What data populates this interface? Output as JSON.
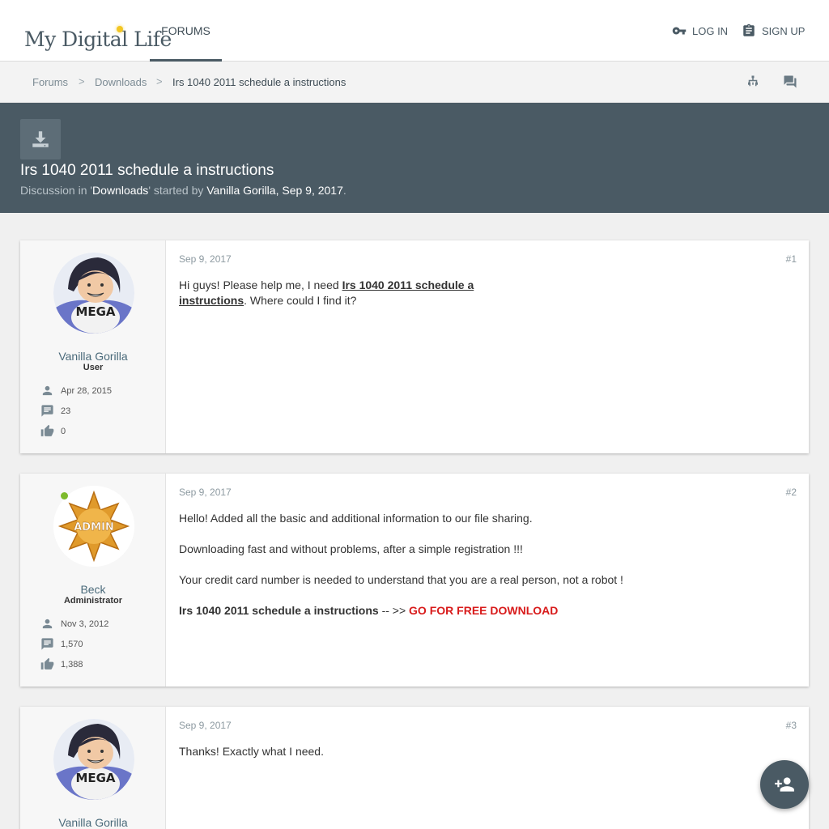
{
  "header": {
    "logo_text": "My Digital Life",
    "nav_tab": "FORUMS",
    "login_label": "LOG IN",
    "signup_label": "SIGN UP"
  },
  "breadcrumb": {
    "items": [
      "Forums",
      "Downloads",
      "Irs 1040 2011 schedule a instructions"
    ],
    "separator": ">"
  },
  "thread": {
    "title": "Irs 1040 2011 schedule a instructions",
    "meta_prefix": "Discussion in '",
    "meta_forum": "Downloads",
    "meta_mid": "' started by ",
    "meta_author": "Vanilla Gorilla",
    "meta_date": ", Sep 9, 2017",
    "meta_end": "."
  },
  "posts": [
    {
      "date": "Sep 9, 2017",
      "number": "#1",
      "username": "Vanilla Gorilla",
      "usertitle": "User",
      "joined": "Apr 28, 2015",
      "messages": "23",
      "likes": "0",
      "text_before": "Hi guys! Please help me, I need ",
      "link_text": "Irs 1040 2011 schedule a instructions",
      "text_after": ". Where could I find it?"
    },
    {
      "date": "Sep 9, 2017",
      "number": "#2",
      "username": "Beck",
      "usertitle": "Administrator",
      "joined": "Nov 3, 2012",
      "messages": "1,570",
      "likes": "1,388",
      "avatar_badge": "ADMIN",
      "para1": "Hello! Added all the basic and additional information to our file sharing.",
      "para2": "Downloading fast and without problems, after a simple registration !!!",
      "para3": "Your credit card number is needed to understand that you are a real person, not a robot !",
      "bold_title": "Irs 1040 2011 schedule a instructions",
      "arrow": " -- >> ",
      "download_label": "GO FOR FREE DOWNLOAD"
    },
    {
      "date": "Sep 9, 2017",
      "number": "#3",
      "username": "Vanilla Gorilla",
      "text": "Thanks! Exactly what I need."
    }
  ],
  "colors": {
    "header_slate": "#4a5a64",
    "download_red": "#d81b1b",
    "online_green": "#7dba2c"
  }
}
